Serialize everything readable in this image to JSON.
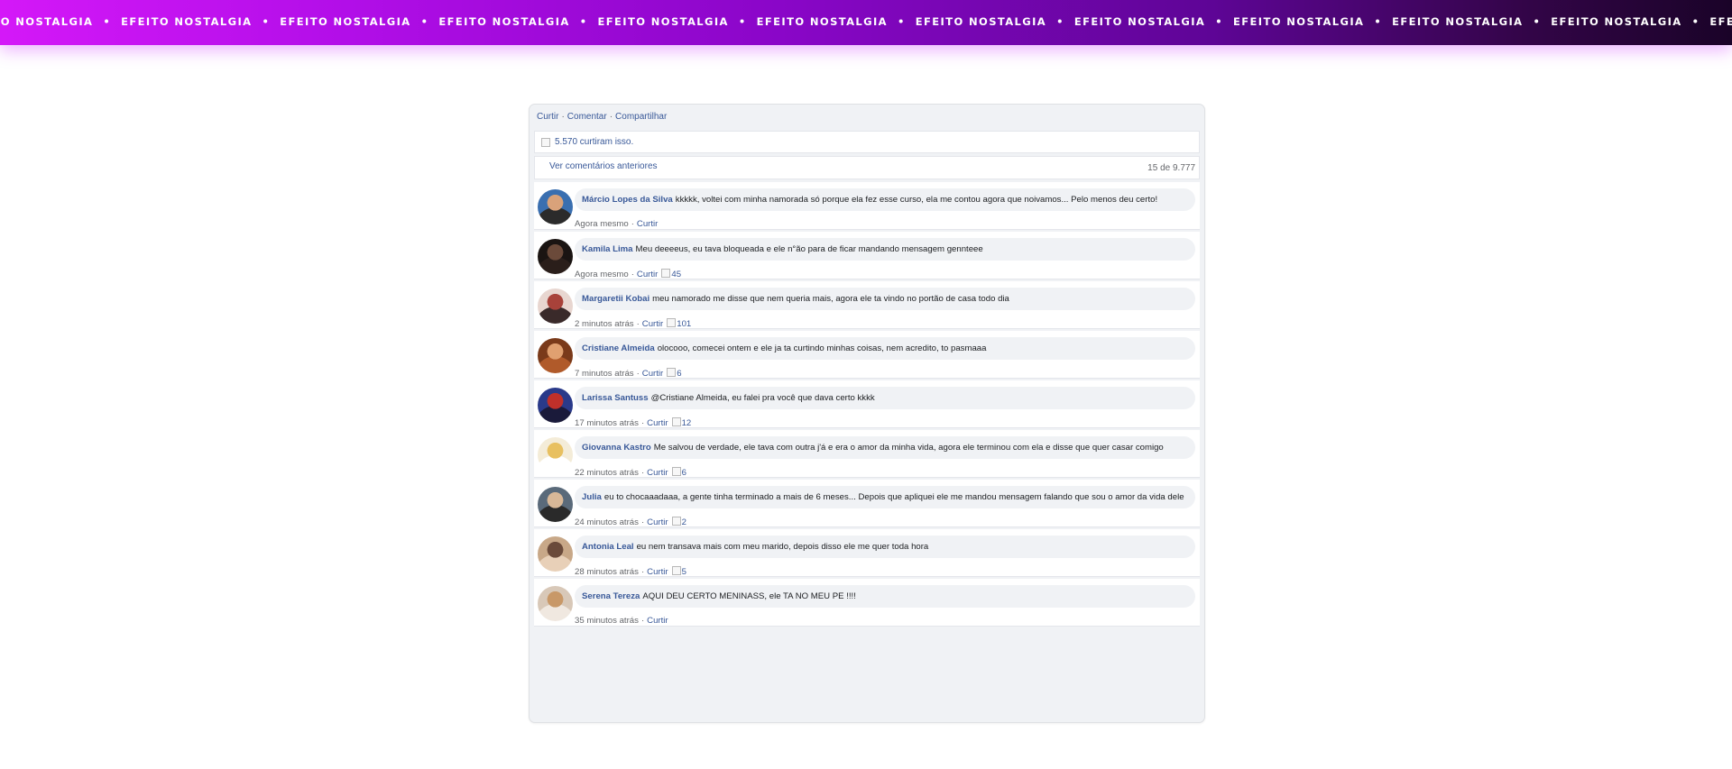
{
  "banner": {
    "text": "EFEITO NOSTALGIA",
    "separator": "•",
    "repeat": 13,
    "gradient": [
      "#d418f8",
      "#8a06c8",
      "#1a0328"
    ]
  },
  "post": {
    "actions": {
      "like": "Curtir",
      "comment": "Comentar",
      "share": "Compartilhar",
      "separator": "·"
    },
    "likes_text": "5.570 curtiram isso.",
    "previous_comments_link": "Ver comentários anteriores",
    "comment_count": "15 de 9.777"
  },
  "comments": [
    {
      "author": "Márcio Lopes da Silva",
      "text": "kkkkk, voltei com minha namorada só porque ela fez esse curso, ela me contou agora que noivamos... Pelo menos deu certo!",
      "time": "Agora mesmo",
      "like_label": "Curtir",
      "reactions": "",
      "avatar_colors": [
        "#3a6fb0",
        "#d9a27a",
        "#2b2b2b"
      ]
    },
    {
      "author": "Kamila Lima",
      "text": "Meu deeeeus, eu tava bloqueada e ele n°ão para de ficar mandando mensagem gennteee",
      "time": "Agora mesmo",
      "like_label": "Curtir",
      "reactions": "45",
      "avatar_colors": [
        "#1a1412",
        "#6b4a3a",
        "#2a1e1a"
      ]
    },
    {
      "author": "Margaretii Kobai",
      "text": "meu namorado me disse que nem queria mais, agora ele ta vindo no portão de casa todo dia",
      "time": "2 minutos atrás",
      "like_label": "Curtir",
      "reactions": "101",
      "avatar_colors": [
        "#e8d6d0",
        "#a8423a",
        "#3a2a2a"
      ]
    },
    {
      "author": "Cristiane Almeida",
      "text": "olocooo, comecei ontem e ele ja ta curtindo minhas coisas, nem acredito, to pasmaaa",
      "time": "7 minutos atrás",
      "like_label": "Curtir",
      "reactions": "6",
      "avatar_colors": [
        "#7a3a1a",
        "#e0a070",
        "#b05a2a"
      ]
    },
    {
      "author": "Larissa Santuss",
      "text": "@Cristiane Almeida, eu falei pra você que dava certo kkkk",
      "time": "17 minutos atrás",
      "like_label": "Curtir",
      "reactions": "12",
      "avatar_colors": [
        "#2a3a8a",
        "#c0302a",
        "#1a1a3a"
      ]
    },
    {
      "author": "Giovanna Kastro",
      "text": "Me salvou de verdade, ele tava com outra j'á e era o amor da minha vida, agora ele terminou com ela e disse que quer casar comigo",
      "time": "22 minutos atrás",
      "like_label": "Curtir",
      "reactions": "6",
      "avatar_colors": [
        "#f4ecd8",
        "#e8c060",
        "#ffffff"
      ]
    },
    {
      "author": "Julia",
      "text": "eu to chocaaadaaa, a gente tinha terminado a mais de 6 meses... Depois que apliquei ele me mandou mensagem falando que sou o amor da vida dele",
      "time": "24 minutos atrás",
      "like_label": "Curtir",
      "reactions": "2",
      "avatar_colors": [
        "#5a6a7a",
        "#d8b898",
        "#2a2a2a"
      ]
    },
    {
      "author": "Antonia Leal",
      "text": "eu nem transava mais com meu marido, depois disso ele me quer toda hora",
      "time": "28 minutos atrás",
      "like_label": "Curtir",
      "reactions": "5",
      "avatar_colors": [
        "#c8a888",
        "#6a4a3a",
        "#e8d0b8"
      ]
    },
    {
      "author": "Serena Tereza",
      "text": "AQUI DEU CERTO MENINASS, ele TA NO MEU PE !!!!",
      "time": "35 minutos atrás",
      "like_label": "Curtir",
      "reactions": "",
      "avatar_colors": [
        "#d8c8b8",
        "#c89868",
        "#f0e8e0"
      ]
    }
  ]
}
